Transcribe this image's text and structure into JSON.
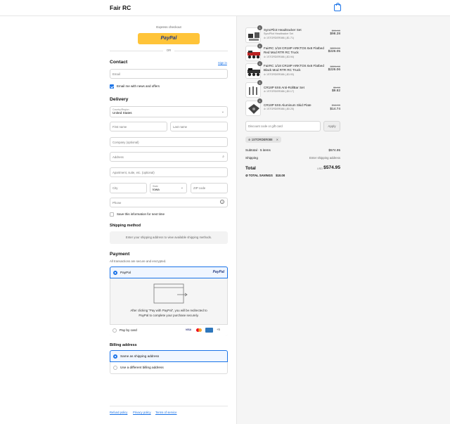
{
  "header": {
    "brand": "Fair RC"
  },
  "express": {
    "label": "Express checkout",
    "paypal": "PayPal",
    "or": "OR"
  },
  "contact": {
    "title": "Contact",
    "sign_in": "Sign in",
    "email_placeholder": "Email",
    "newsletter_label": "Email me with news and offers"
  },
  "delivery": {
    "title": "Delivery",
    "country_label": "Country/Region",
    "country_value": "United States",
    "first_name": "First name",
    "last_name": "Last name",
    "company": "Company (optional)",
    "address": "Address",
    "apartment": "Apartment, suite, etc. (optional)",
    "city": "City",
    "state_label": "State",
    "state_value": "Iowa",
    "zip": "ZIP code",
    "phone": "Phone",
    "save_info": "Save this information for next time"
  },
  "shipping": {
    "title": "Shipping method",
    "notice": "Enter your shipping address to view available shipping methods."
  },
  "payment": {
    "title": "Payment",
    "subtitle": "All transactions are secure and encrypted.",
    "paypal_label": "PayPal",
    "paypal_logo": "PayPal",
    "redirect_text": "After clicking “Pay with PayPal”, you will be redirected to PayPal to complete your purchase securely.",
    "card_label": "Pay by card",
    "card_more": "+5"
  },
  "billing": {
    "title": "Billing address",
    "same": "Same as shipping address",
    "different": "Use a different billing address"
  },
  "footer": {
    "refund": "Refund policy",
    "privacy": "Privacy policy",
    "terms": "Terms of service"
  },
  "cart": {
    "items": [
      {
        "qty": "1",
        "name": "SyncPilot Headtracker Set",
        "variant": "SyncPilot Headtracker Set",
        "discount": "1STORDER088 (-$1.71)",
        "old_price": "$99.99",
        "price": "$98.28"
      },
      {
        "qty": "1",
        "name": "FairRC 1/18 CR18P ARKTOS 6x6 Flatbed Red Mod RTR RC Truck",
        "variant": "",
        "discount": "1STORDER088 (-$3.94)",
        "old_price": "$229.99",
        "price": "$226.05"
      },
      {
        "qty": "1",
        "name": "FairRC 1/18 CR18P ARKTOS 6x6 Flatbed Black Mod RTR RC Truck",
        "variant": "",
        "discount": "1STORDER088 (-$3.93)",
        "old_price": "$229.99",
        "price": "$226.06"
      },
      {
        "qty": "1",
        "name": "CR18P 6X6 Anti-RollBar Set",
        "variant": "",
        "discount": "1STORDER088 (-$0.17)",
        "old_price": "$9.99",
        "price": "$9.82"
      },
      {
        "qty": "1",
        "name": "CR18P 6X6 Aluminum Skid Plate",
        "variant": "",
        "discount": "1STORDER088 (-$0.25)",
        "old_price": "$14.99",
        "price": "$14.74"
      }
    ],
    "discount_placeholder": "Discount code or gift card",
    "apply": "Apply",
    "applied_code": "1STORDER088",
    "subtotal_label": "Subtotal · 5 items",
    "subtotal": "$574.95",
    "shipping_label": "Shipping",
    "shipping_value": "Enter shipping address",
    "total_label": "Total",
    "currency": "USD",
    "total": "$574.95",
    "savings_label": "TOTAL SAVINGS",
    "savings": "$10.00"
  }
}
